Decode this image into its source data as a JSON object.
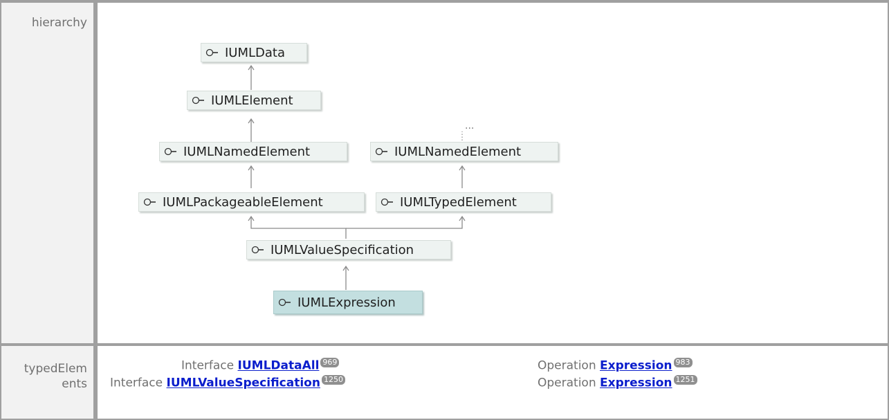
{
  "rows": {
    "hierarchy_label": "hierarchy",
    "typed_label": "typedElem\nents"
  },
  "nodes": {
    "data": "IUMLData",
    "element": "IUMLElement",
    "named_left": "IUMLNamedElement",
    "named_right": "IUMLNamedElement",
    "packageable": "IUMLPackageableElement",
    "typed": "IUMLTypedElement",
    "value_spec": "IUMLValueSpecification",
    "expression": "IUMLExpression",
    "ellipsis": "..."
  },
  "icons": {
    "interface": "interface-lollipop-icon"
  },
  "typed_elements": [
    {
      "kind": "Interface",
      "name": "IUMLDataAll",
      "badge": "969"
    },
    {
      "kind": "Operation",
      "name": "Expression",
      "badge": "983"
    },
    {
      "kind": "Interface",
      "name": "IUMLValueSpecification",
      "badge": "1250"
    },
    {
      "kind": "Operation",
      "name": "Expression",
      "badge": "1251"
    }
  ],
  "colors": {
    "node_bg": "#eef3f1",
    "selected_bg": "#c3dfe0",
    "link": "#0b1ecc",
    "badge": "#8f8f8f"
  }
}
